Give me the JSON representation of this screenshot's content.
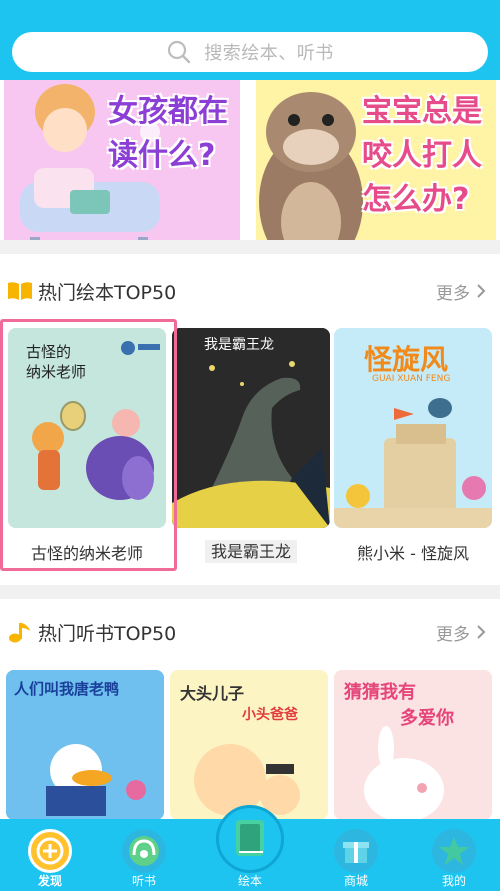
{
  "search": {
    "placeholder": "搜索绘本、听书"
  },
  "banner": [
    {
      "text_line1": "女孩都在",
      "text_line2": "读什么?"
    },
    {
      "text_line1": "宝宝总是",
      "text_line2": "咬人打人",
      "text_line3": "怎么办?"
    }
  ],
  "sections": {
    "picture_books": {
      "title": "热门绘本TOP50",
      "more": "更多",
      "items": [
        {
          "label": "古怪的纳米老师",
          "cover_title": "古怪的\n纳米老师"
        },
        {
          "label": "我是霸王龙",
          "cover_title": "我是霸王龙"
        },
        {
          "label": "熊小米 - 怪旋风",
          "cover_title": "怪旋风",
          "cover_sub": "GUAI XUAN FENG"
        }
      ]
    },
    "audio_books": {
      "title": "热门听书TOP50",
      "more": "更多",
      "items": [
        {
          "cover_title": "人们叫我唐老鸭"
        },
        {
          "cover_title": "大头儿子",
          "cover_sub": "小头爸爸"
        },
        {
          "cover_title": "猜猜我有",
          "cover_sub": "多爱你"
        }
      ]
    }
  },
  "tabbar": {
    "items": [
      {
        "label": "发现"
      },
      {
        "label": "听书"
      },
      {
        "label": "绘本"
      },
      {
        "label": "商城"
      },
      {
        "label": "我的"
      }
    ]
  },
  "colors": {
    "accent": "#1ec4f0",
    "selected_frame": "#f06a9a",
    "muted": "#999999"
  }
}
